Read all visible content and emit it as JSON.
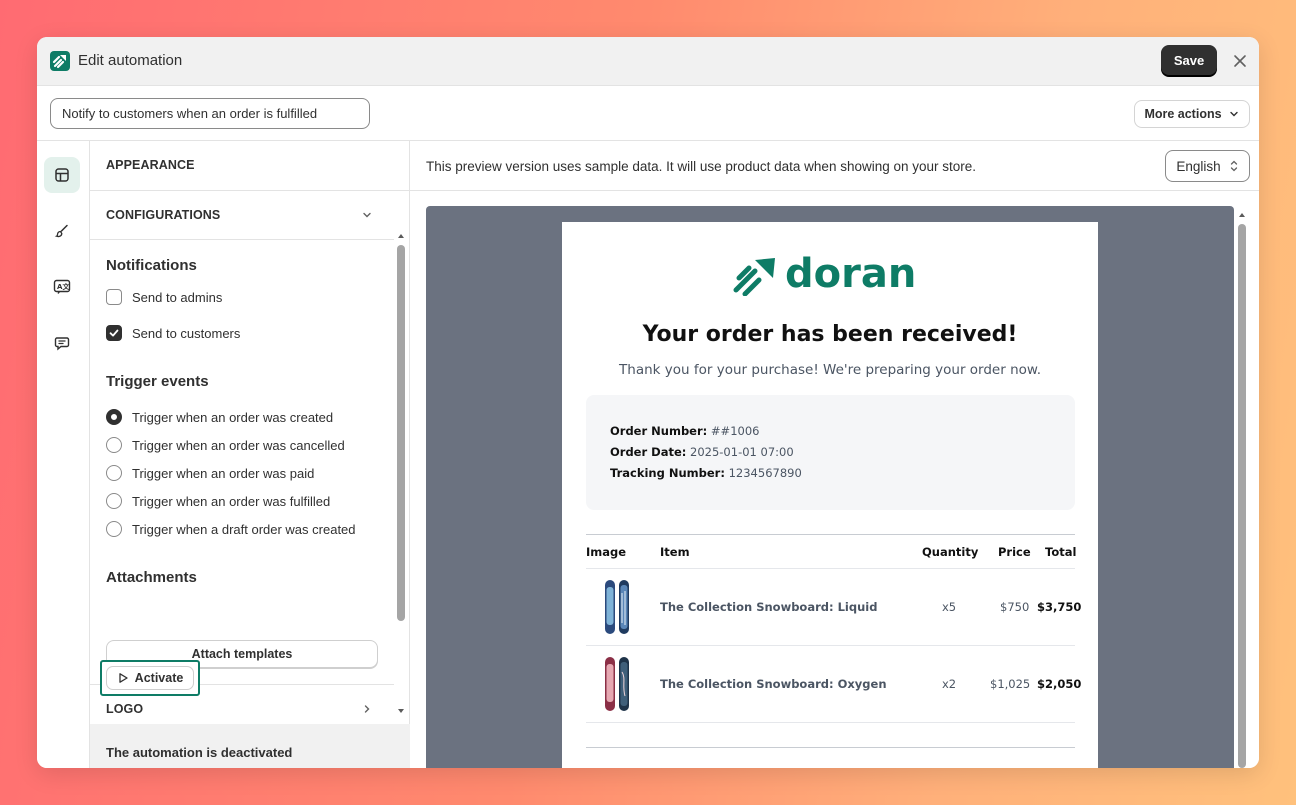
{
  "window": {
    "title": "Edit automation"
  },
  "titlebar": {
    "save_label": "Save"
  },
  "toolbar": {
    "automation_name": "Notify to customers when an order is fulfilled",
    "more_actions_label": "More actions"
  },
  "rail": {
    "icons": [
      "layout-icon",
      "brush-icon",
      "translate-icon",
      "chat-icon"
    ],
    "accent": "#0e7c66"
  },
  "settings": {
    "appearance_label": "APPEARANCE",
    "configurations_label": "CONFIGURATIONS",
    "notifications_title": "Notifications",
    "notifications": [
      {
        "label": "Send to admins",
        "checked": false
      },
      {
        "label": "Send to customers",
        "checked": true
      }
    ],
    "trigger_title": "Trigger events",
    "triggers": [
      {
        "label": "Trigger when an order was created",
        "selected": true
      },
      {
        "label": "Trigger when an order was cancelled",
        "selected": false
      },
      {
        "label": "Trigger when an order was paid",
        "selected": false
      },
      {
        "label": "Trigger when an order was fulfilled",
        "selected": false
      },
      {
        "label": "Trigger when a draft order was created",
        "selected": false
      }
    ],
    "attachments_title": "Attachments",
    "attach_button": "Attach templates",
    "logo_label": "LOGO",
    "status_text": "The automation is deactivated",
    "activate_label": "Activate"
  },
  "preview": {
    "note": "This preview version uses sample data. It will use product data when showing on your store.",
    "language": "English",
    "email": {
      "brand_name": "doran",
      "brand_color": "#0e7c66",
      "title": "Your order has been received!",
      "subtitle": "Thank you for your purchase! We're preparing your order now.",
      "order_number_label": "Order Number:",
      "order_number": "##1006",
      "order_date_label": "Order Date:",
      "order_date": "2025-01-01 07:00",
      "tracking_label": "Tracking Number:",
      "tracking_number": "1234567890",
      "columns": {
        "image": "Image",
        "item": "Item",
        "quantity": "Quantity",
        "price": "Price",
        "total": "Total"
      },
      "rows": [
        {
          "item": "The Collection Snowboard: Liquid",
          "quantity": "x5",
          "price": "$750",
          "total": "$3,750"
        },
        {
          "item": "The Collection Snowboard: Oxygen",
          "quantity": "x2",
          "price": "$1,025",
          "total": "$2,050"
        }
      ]
    }
  }
}
